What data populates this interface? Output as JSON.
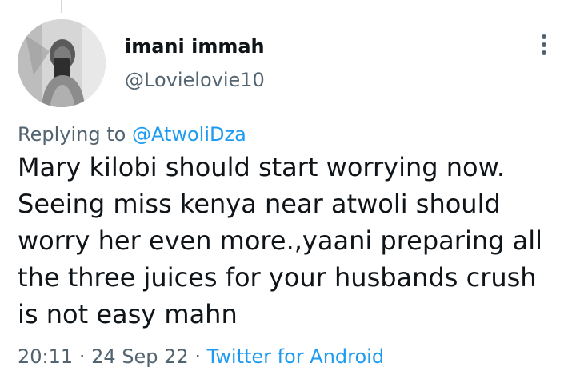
{
  "tweet": {
    "author_name": "imani immah",
    "author_handle": "@Lovielovie10",
    "replying_prefix": "Replying to",
    "replying_to": "@AtwoliDza",
    "body_lines": [
      "Mary kilobi should start worrying now.",
      "Seeing miss kenya near atwoli should",
      "worry her even more.,yaani preparing all",
      "the three juices for your husbands crush",
      "is not easy mahn"
    ],
    "time": "20:11",
    "separator": "·",
    "date": "24 Sep 22",
    "source": "Twitter for Android"
  },
  "icons": {
    "more": "more-vertical-icon",
    "avatar": "profile-photo"
  },
  "colors": {
    "primary_text": "#0f1419",
    "secondary_text": "#536471",
    "link": "#1d9bf0",
    "background": "#ffffff"
  }
}
